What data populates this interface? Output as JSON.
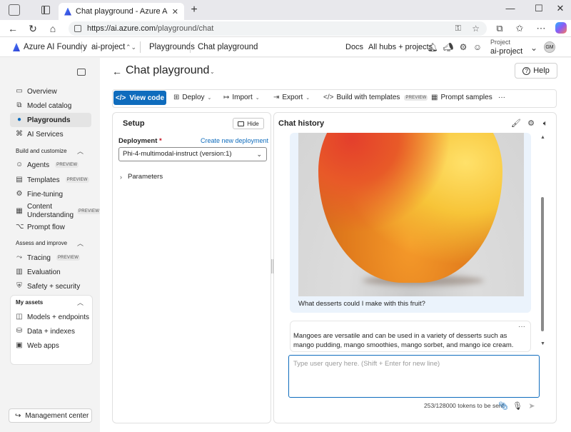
{
  "browser": {
    "tab_title": "Chat playground - Azure AI Foundry",
    "tab_close": "✕",
    "new_tab": "+",
    "url_host": "https://ai.azure.com",
    "url_path": "/playground/chat",
    "window_controls": [
      "—",
      "☐",
      "✕"
    ]
  },
  "header": {
    "brand": "Azure AI Foundry",
    "project_crumb": "ai-project",
    "crumb_playgrounds": "Playgrounds",
    "crumb_current": "Chat playground",
    "docs": "Docs",
    "all_hubs": "All hubs + projects",
    "project_label": "Project",
    "project_value": "ai-project",
    "avatar_initials": "GM"
  },
  "sidebar": {
    "items_top": [
      {
        "label": "Overview",
        "icon": "overview-icon",
        "glyph": "▭"
      },
      {
        "label": "Model catalog",
        "icon": "model-catalog-icon",
        "glyph": "⧉"
      },
      {
        "label": "Playgrounds",
        "icon": "playgrounds-icon",
        "glyph": "💬"
      },
      {
        "label": "AI Services",
        "icon": "ai-services-icon",
        "glyph": "⌘"
      }
    ],
    "section_build": "Build and customize",
    "items_build": [
      {
        "label": "Agents",
        "badge": "PREVIEW",
        "glyph": "☺"
      },
      {
        "label": "Templates",
        "badge": "PREVIEW",
        "glyph": "▤"
      },
      {
        "label": "Fine-tuning",
        "glyph": "⚙"
      },
      {
        "label": "Content Understanding",
        "badge": "PREVIEW",
        "glyph": "▦"
      },
      {
        "label": "Prompt flow",
        "glyph": "⌥"
      }
    ],
    "section_assess": "Assess and improve",
    "items_assess": [
      {
        "label": "Tracing",
        "badge": "PREVIEW",
        "glyph": "⤳"
      },
      {
        "label": "Evaluation",
        "glyph": "▥"
      },
      {
        "label": "Safety + security",
        "glyph": "⛨"
      }
    ],
    "section_assets": "My assets",
    "items_assets": [
      {
        "label": "Models + endpoints",
        "glyph": "◫"
      },
      {
        "label": "Data + indexes",
        "glyph": "⛁"
      },
      {
        "label": "Web apps",
        "glyph": "▣"
      }
    ],
    "management": "Management center"
  },
  "page": {
    "title": "Chat playground",
    "help": "Help"
  },
  "toolbar": {
    "view_code": "View code",
    "deploy": "Deploy",
    "import": "Import",
    "export": "Export",
    "build_templates": "Build with templates",
    "build_badge": "PREVIEW",
    "prompt_samples": "Prompt samples",
    "more": "···"
  },
  "setup": {
    "title": "Setup",
    "hide": "Hide",
    "deployment_label": "Deployment",
    "required_mark": "*",
    "create_link": "Create new deployment",
    "deployment_value": "Phi-4-multimodal-instruct (version:1)",
    "parameters": "Parameters"
  },
  "chat": {
    "title": "Chat history",
    "user_message": "What desserts could I make with this fruit?",
    "bot_message": "Mangoes are versatile and can be used in a variety of desserts such as mango pudding, mango smoothies, mango sorbet, and mango ice cream.",
    "input_placeholder": "Type user query here. (Shift + Enter for new line)",
    "tokens": "253/128000 tokens to be sent"
  },
  "colors": {
    "accent": "#0f6cbd",
    "required": "#c50f1f",
    "user_bubble": "#ebf3fc"
  }
}
